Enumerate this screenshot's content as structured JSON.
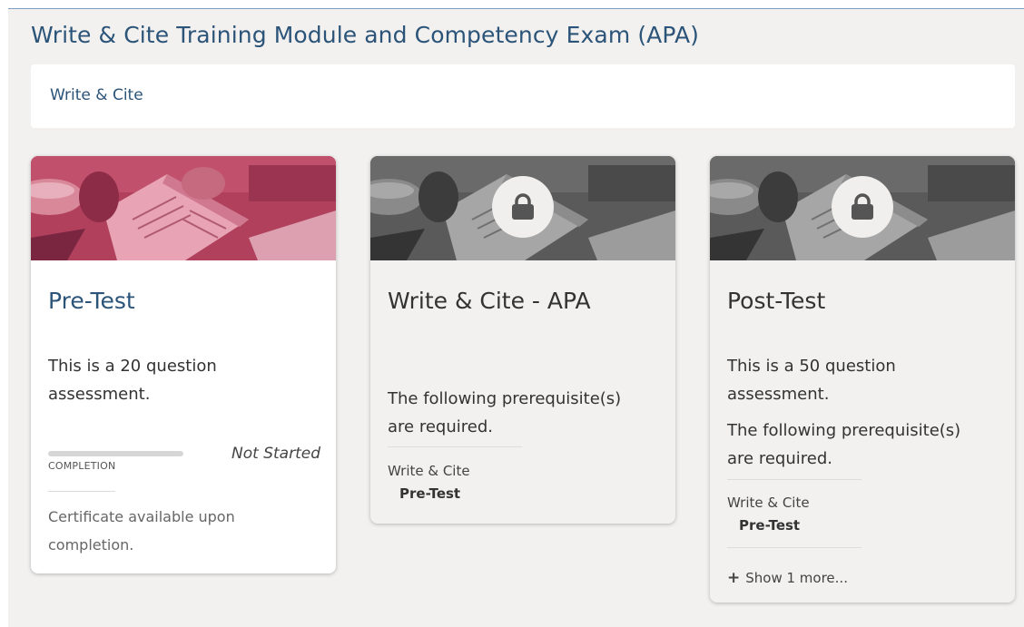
{
  "page": {
    "title": "Write & Cite Training Module and Competency Exam (APA)",
    "breadcrumb": "Write & Cite"
  },
  "colors": {
    "title_blue": "#2b5478",
    "banner_red": "#b0405c",
    "banner_gray": "#5a5a5a",
    "page_bg": "#f2f1f0"
  },
  "cards": [
    {
      "title": "Pre-Test",
      "locked": false,
      "description": "This is a 20 question assessment.",
      "progress_label": "COMPLETION",
      "progress": 0,
      "status": "Not Started",
      "certificate": "Certificate available upon completion."
    },
    {
      "title": "Write & Cite - APA",
      "locked": true,
      "lock_icon": "lock-icon",
      "prereq_text": "The following prerequisite(s) are required.",
      "prereq_group": "Write & Cite",
      "prereq_item": "Pre-Test"
    },
    {
      "title": "Post-Test",
      "locked": true,
      "lock_icon": "lock-icon",
      "description": "This is a 50 question assessment.",
      "prereq_text": "The following prerequisite(s) are required.",
      "prereq_group": "Write & Cite",
      "prereq_item": "Pre-Test",
      "show_more": "Show 1 more..."
    }
  ]
}
